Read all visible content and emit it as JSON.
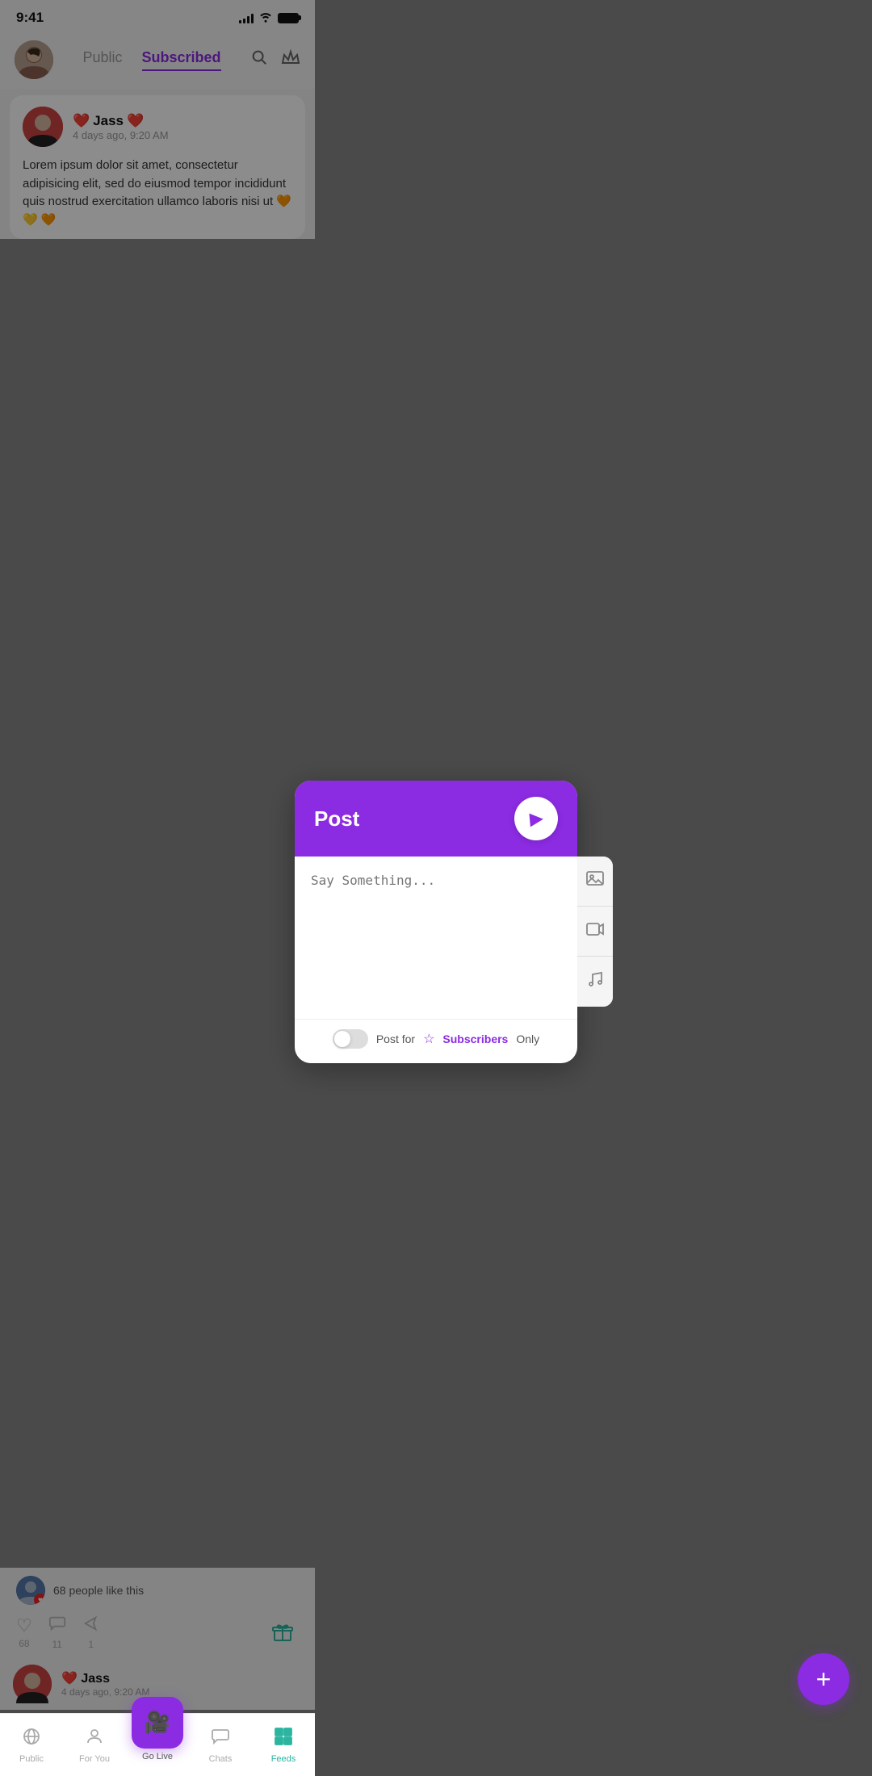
{
  "statusBar": {
    "time": "9:41",
    "signal": "signal",
    "wifi": "wifi",
    "battery": "battery"
  },
  "header": {
    "tabs": [
      {
        "id": "public",
        "label": "Public",
        "active": false
      },
      {
        "id": "subscribed",
        "label": "Subscribed",
        "active": true
      }
    ],
    "searchLabel": "search",
    "crownLabel": "crown"
  },
  "post": {
    "username": "Jass",
    "timestamp": "4 days ago, 9:20 AM",
    "text": "Lorem ipsum dolor sit amet, consectetur adipisicing elit, sed do eiusmod tempor incididunt  quis nostrud exercitation ullamco laboris nisi ut 🧡 💛 🧡"
  },
  "modal": {
    "title": "Post",
    "sendLabel": "send",
    "placeholder": "Say Something...",
    "imageIconLabel": "image-icon",
    "videoIconLabel": "video-icon",
    "musicIconLabel": "music-icon",
    "footer": {
      "postForLabel": "Post for",
      "subscribersLabel": "Subscribers",
      "onlyLabel": "Only",
      "toggleState": false
    }
  },
  "engagement": {
    "likesCount": "68 people like this",
    "heartCount": "68",
    "commentCount": "11",
    "shareCount": "1"
  },
  "secondPost": {
    "username": "Jass",
    "timestamp": "4 days ago, 9:20 AM"
  },
  "bottomNav": {
    "items": [
      {
        "id": "public",
        "label": "Public",
        "icon": "📡",
        "active": false
      },
      {
        "id": "foryou",
        "label": "For You",
        "icon": "person",
        "active": false
      },
      {
        "id": "golive",
        "label": "Go Live",
        "icon": "🎥",
        "active": false
      },
      {
        "id": "chats",
        "label": "Chats",
        "icon": "💬",
        "active": false
      },
      {
        "id": "feeds",
        "label": "Feeds",
        "icon": "feeds",
        "active": true
      }
    ]
  },
  "fab": {
    "icon": "+"
  }
}
